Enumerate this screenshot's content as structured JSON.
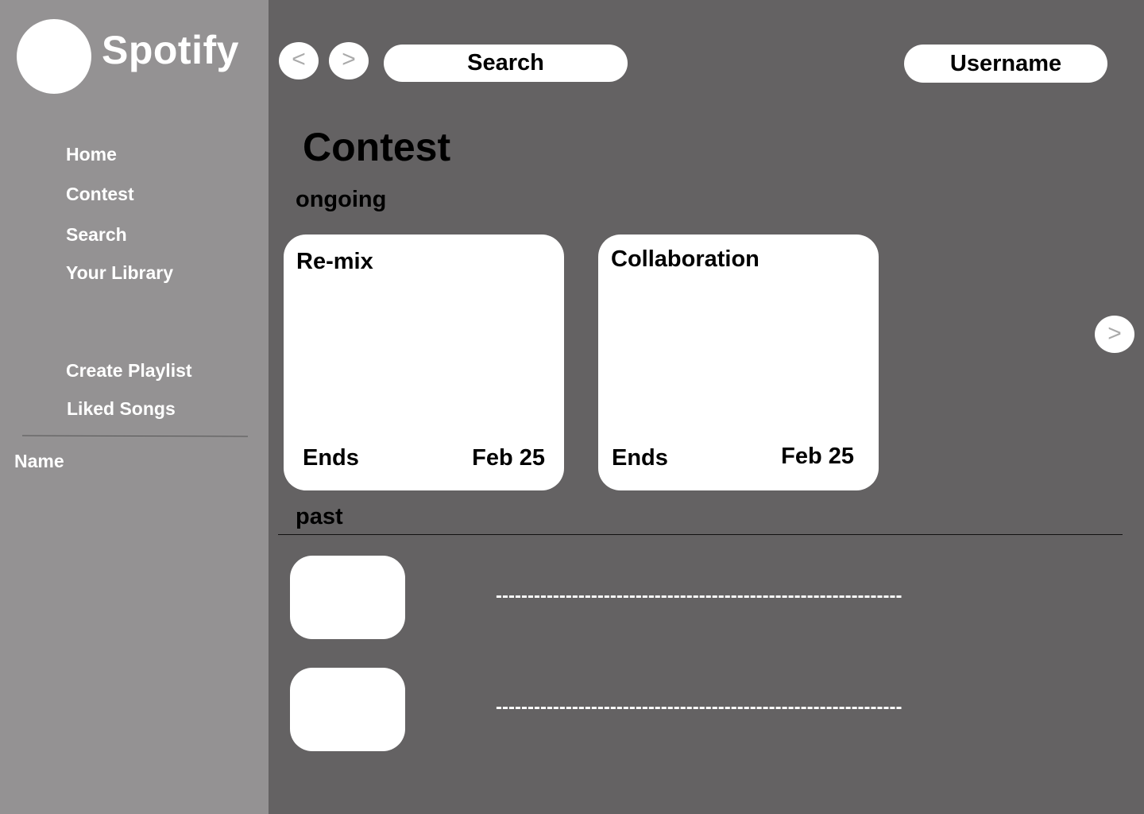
{
  "sidebar": {
    "brand": "Spotify",
    "nav": [
      {
        "label": "Home"
      },
      {
        "label": "Contest"
      },
      {
        "label": "Search"
      },
      {
        "label": "Your Library"
      }
    ],
    "actions": [
      {
        "label": "Create Playlist"
      },
      {
        "label": "Liked Songs"
      }
    ],
    "playlist_name": "Name"
  },
  "topbar": {
    "back_label": "<",
    "forward_label": ">",
    "search_label": "Search",
    "username": "Username"
  },
  "main": {
    "title": "Contest",
    "ongoing_label": "ongoing",
    "ongoing": [
      {
        "title": "Re-mix",
        "ends_label": "Ends",
        "date": "Feb 25"
      },
      {
        "title": "Collaboration",
        "ends_label": "Ends",
        "date": "Feb 25"
      }
    ],
    "carousel_next_label": ">",
    "past_label": "past",
    "past": [
      {
        "text": "----------------------------------------------------------------"
      },
      {
        "text": "----------------------------------------------------------------"
      }
    ]
  }
}
